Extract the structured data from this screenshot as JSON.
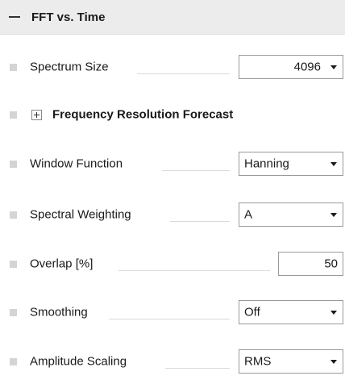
{
  "header": {
    "title": "FFT vs. Time"
  },
  "rows": {
    "spectrum_size": {
      "label": "Spectrum Size",
      "value": "4096"
    },
    "frequency_resolution": {
      "label": "Frequency Resolution Forecast"
    },
    "window_function": {
      "label": "Window Function",
      "value": "Hanning"
    },
    "spectral_weighting": {
      "label": "Spectral Weighting",
      "value": "A"
    },
    "overlap": {
      "label": "Overlap [%]",
      "value": "50"
    },
    "smoothing": {
      "label": "Smoothing",
      "value": "Off"
    },
    "amplitude_scaling": {
      "label": "Amplitude Scaling",
      "value": "RMS"
    }
  },
  "icons": {
    "collapse": "minus-icon",
    "expander": "plus-box-icon",
    "dropdown": "caret-down-icon",
    "bullet": "square-bullet-icon"
  },
  "colors": {
    "header_bg": "#ececec",
    "border": "#9a9a9a",
    "bullet": "#d4d4d4"
  }
}
